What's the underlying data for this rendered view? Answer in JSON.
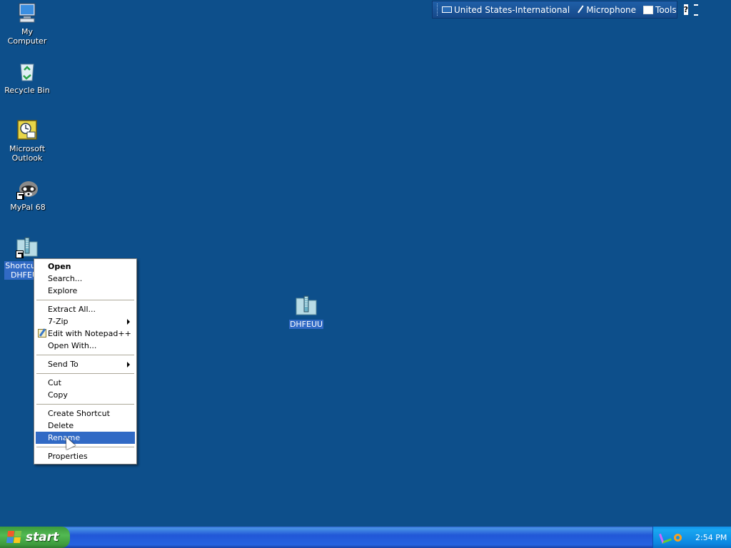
{
  "desktop_icons": [
    {
      "label": "My Computer",
      "icon": "computer-icon"
    },
    {
      "label": "Recycle Bin",
      "icon": "recycle-bin-icon"
    },
    {
      "label": "Microsoft\nOutlook",
      "icon": "outlook-icon"
    },
    {
      "label": "MyPal 68",
      "icon": "mypal-icon"
    },
    {
      "label": "Shortcut to\nDHFEUU",
      "icon": "zip-folder-shortcut-icon"
    },
    {
      "label": "DHFEUU",
      "icon": "zip-folder-icon"
    }
  ],
  "language_bar": {
    "keyboard": "United States-International",
    "microphone": "Microphone",
    "tools": "Tools",
    "help": "?"
  },
  "context_menu": {
    "open": "Open",
    "search": "Search...",
    "explore": "Explore",
    "extract_all": "Extract All...",
    "seven_zip": "7-Zip",
    "notepad": "Edit with Notepad++",
    "open_with": "Open With...",
    "send_to": "Send To",
    "cut": "Cut",
    "copy": "Copy",
    "create_shortcut": "Create Shortcut",
    "delete": "Delete",
    "rename": "Rename",
    "properties": "Properties"
  },
  "taskbar": {
    "start_label": "start",
    "clock": "2:54 PM"
  },
  "colors": {
    "desktop": "#0d4f8b",
    "selection": "#316ac5",
    "start_green": "#3c9a3c",
    "taskbar_blue": "#2157d7"
  }
}
